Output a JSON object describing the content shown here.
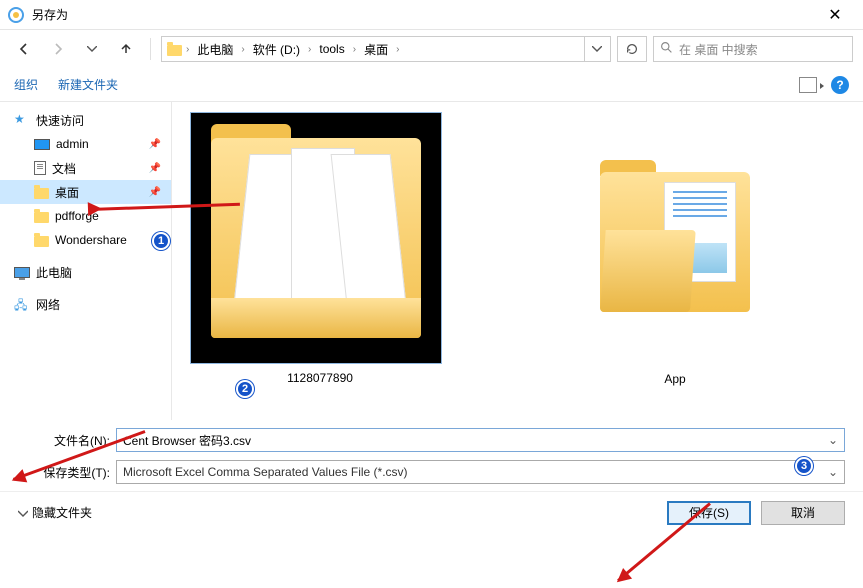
{
  "window": {
    "title": "另存为"
  },
  "nav": {
    "breadcrumb": [
      "此电脑",
      "软件 (D:)",
      "tools",
      "桌面"
    ],
    "search_placeholder": "在 桌面 中搜索"
  },
  "toolbar": {
    "organize": "组织",
    "new_folder": "新建文件夹"
  },
  "sidebar": {
    "quick_access": "快速访问",
    "items": [
      {
        "label": "admin",
        "icon": "monitor",
        "pinned": true
      },
      {
        "label": "文档",
        "icon": "doc",
        "pinned": true
      },
      {
        "label": "桌面",
        "icon": "folder",
        "pinned": true,
        "selected": true
      },
      {
        "label": "pdfforge",
        "icon": "folder",
        "pinned": false
      },
      {
        "label": "Wondershare",
        "icon": "folder",
        "pinned": false
      }
    ],
    "this_pc": "此电脑",
    "network": "网络"
  },
  "content": {
    "items": [
      {
        "label": "1128077890"
      },
      {
        "label": "App"
      }
    ]
  },
  "form": {
    "filename_label": "文件名(N):",
    "filename_value": "Cent Browser 密码3.csv",
    "type_label": "保存类型(T):",
    "type_value": "Microsoft Excel Comma Separated Values File (*.csv)"
  },
  "footer": {
    "hide_folders": "隐藏文件夹",
    "save": "保存(S)",
    "cancel": "取消"
  },
  "annotations": {
    "b1": "1",
    "b2": "2",
    "b3": "3"
  }
}
